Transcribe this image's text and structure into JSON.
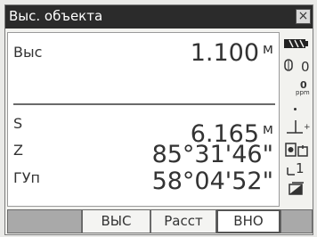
{
  "window": {
    "title": "Выс. объекта"
  },
  "measurements": {
    "height": {
      "label": "Выс",
      "value": "1.100",
      "unit": "м"
    },
    "slope_distance": {
      "label": "S",
      "value": "6.165",
      "unit": "м"
    },
    "zenith_angle": {
      "label": "Z",
      "value": "85°31'46\""
    },
    "horizontal_angle": {
      "label": "ГУп",
      "value": "58°04'52\""
    }
  },
  "status_bar": {
    "prism_constant": "0",
    "ppm_value": "0",
    "ppm_unit": "ppm",
    "face_number": "1"
  },
  "softkeys": [
    {
      "label": ""
    },
    {
      "label": "ВЫС"
    },
    {
      "label": "Расст"
    },
    {
      "label": "ВНО"
    }
  ],
  "colors": {
    "titlebar": "#2b2b2b",
    "window_bg": "#f2f2ef",
    "panel_bg": "#ffffff",
    "softkey_empty": "#a9a9a9"
  }
}
